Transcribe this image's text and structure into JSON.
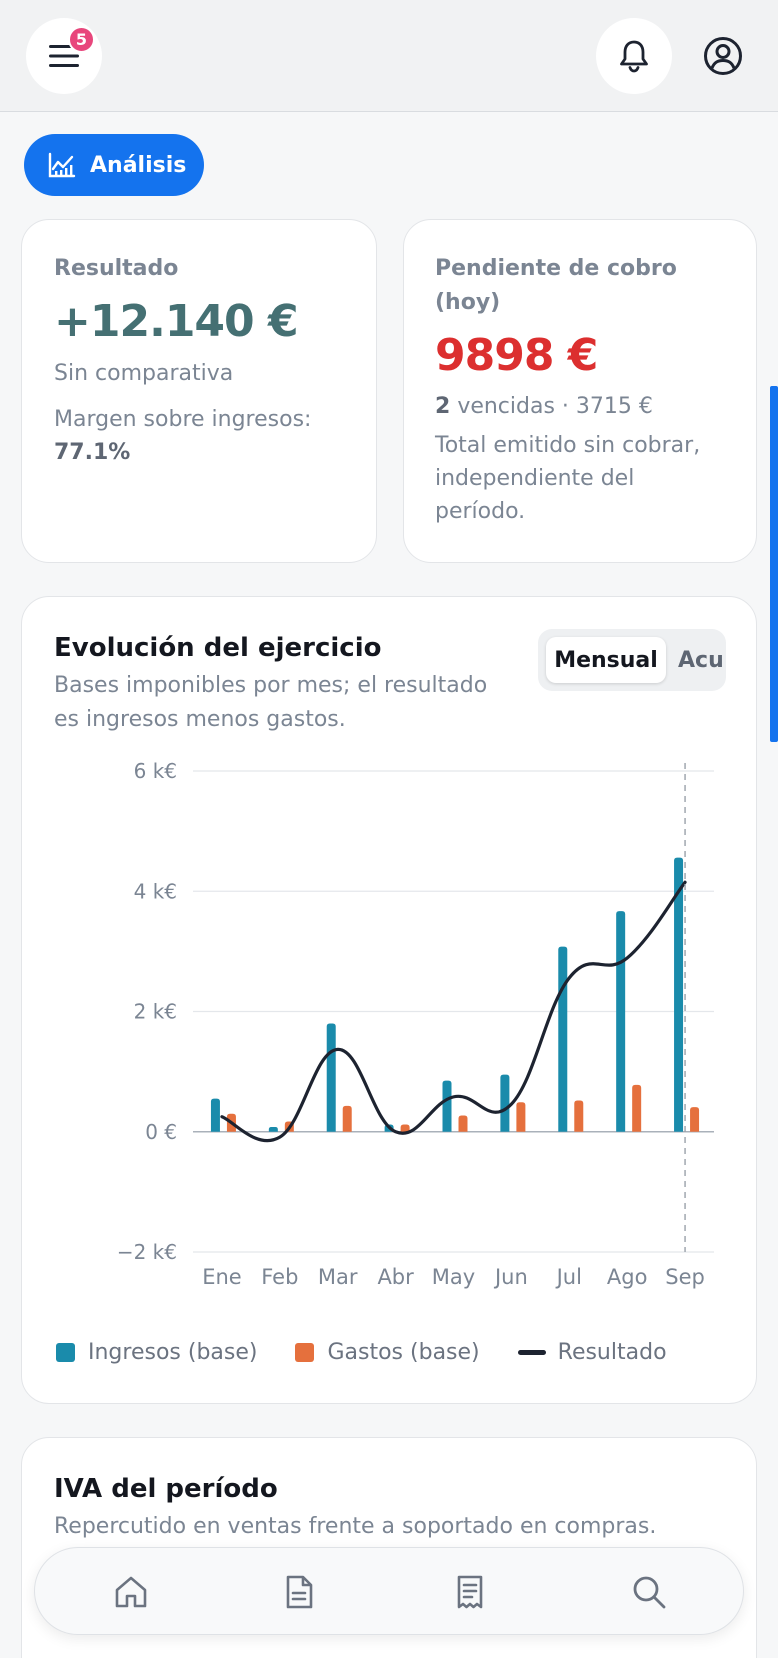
{
  "header": {
    "notification_count": "5",
    "icons": [
      "menu-icon",
      "bell-icon",
      "user-icon"
    ]
  },
  "section_pill": {
    "label": "Análisis",
    "icon": "chart-icon"
  },
  "result_card": {
    "title": "Resultado",
    "value": "+12.140 €",
    "comparison": "Sin comparativa",
    "margin_label": "Margen sobre ingresos:",
    "margin_value": "77.1%"
  },
  "pending_card": {
    "title_line1": "Pendiente de cobro",
    "title_line2": "(hoy)",
    "value": "9898 €",
    "overdue_count": "2",
    "overdue_text": "vencidas · 3715 €",
    "note_line1": "Total emitido sin cobrar,",
    "note_line2": "independiente del",
    "note_line3": "período."
  },
  "evolution_card": {
    "title": "Evolución del ejercicio",
    "subtitle_line1": "Bases imponibles por mes; el resultado",
    "subtitle_line2": "es ingresos menos gastos.",
    "toggle": {
      "active": "Mensual",
      "inactive": "Acu"
    }
  },
  "chart_data": {
    "type": "bar",
    "categories": [
      "Ene",
      "Feb",
      "Mar",
      "Abr",
      "May",
      "Jun",
      "Jul",
      "Ago",
      "Sep"
    ],
    "series": [
      {
        "name": "Ingresos (base)",
        "type": "bar",
        "color": "#1a8bab",
        "values": [
          550,
          80,
          1800,
          120,
          850,
          950,
          3080,
          3670,
          4560
        ]
      },
      {
        "name": "Gastos (base)",
        "type": "bar",
        "color": "#e5703d",
        "values": [
          300,
          170,
          430,
          120,
          270,
          490,
          520,
          780,
          410
        ]
      },
      {
        "name": "Resultado",
        "type": "line",
        "color": "#1d2330",
        "values": [
          250,
          -90,
          1370,
          0,
          580,
          460,
          2560,
          2890,
          4150
        ]
      }
    ],
    "y_ticks": [
      "6 k€",
      "4 k€",
      "2 k€",
      "0 €",
      "−2 k€"
    ],
    "ylim": [
      -2000,
      6000
    ],
    "grid": true,
    "legend": "bottom"
  },
  "iva_card": {
    "title": "IVA del período",
    "subtitle": "Repercutido en ventas frente a soportado en compras."
  },
  "bottom_nav": {
    "items": [
      "home-icon",
      "document-icon",
      "receipt-icon",
      "search-icon"
    ]
  }
}
